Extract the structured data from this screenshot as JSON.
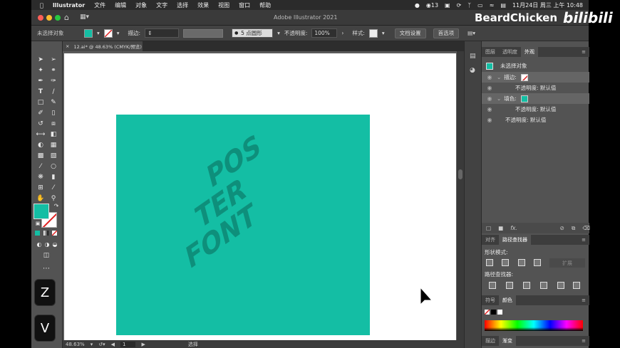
{
  "menubar": {
    "app": "Illustrator",
    "items": [
      "文件",
      "编辑",
      "对象",
      "文字",
      "选择",
      "效果",
      "视图",
      "窗口",
      "帮助"
    ],
    "notification_count": "13",
    "datetime": "11月24日 周三 上午 10:48"
  },
  "window": {
    "title": "Adobe Illustrator 2021"
  },
  "watermark": {
    "channel": "BeardChicken",
    "site": "bilibili"
  },
  "control_bar": {
    "selection_label": "未选择对象",
    "stroke_label": "描边:",
    "brush_label": "5 点圆形",
    "opacity_label": "不透明度:",
    "opacity_value": "100%",
    "style_label": "样式:",
    "doc_settings_button": "文档设置",
    "preferences_button": "首选项"
  },
  "document": {
    "tab_label": "12.ai* @ 48.63% (CMYK/预览)",
    "poster_lines": [
      "POS",
      "TER",
      "FONT"
    ]
  },
  "status_bar": {
    "zoom": "48.63%",
    "artboard": "1",
    "tool": "选择"
  },
  "colors": {
    "poster": "#14bea4",
    "fill_swatch": "#14bea4"
  },
  "appearance_panel": {
    "tabs": [
      "图层",
      "透明度",
      "外观"
    ],
    "header": "未选择对象",
    "rows": [
      {
        "label": "描边:",
        "indent": false
      },
      {
        "label": "不透明度: 默认值",
        "indent": true
      },
      {
        "label": "填色:",
        "indent": false
      },
      {
        "label": "不透明度: 默认值",
        "indent": true
      },
      {
        "label": "不透明度: 默认值",
        "indent": false
      }
    ]
  },
  "pathfinder_panel": {
    "tabs": [
      "对齐",
      "路径查找器"
    ],
    "shape_modes_label": "形状模式:",
    "expand_button": "扩展",
    "pathfinders_label": "路径查找器:"
  },
  "color_panel": {
    "tabs": [
      "符号",
      "颜色"
    ]
  },
  "bottom_panel": {
    "tabs": [
      "描边",
      "渐变"
    ]
  },
  "keys": [
    "Z",
    "V"
  ]
}
